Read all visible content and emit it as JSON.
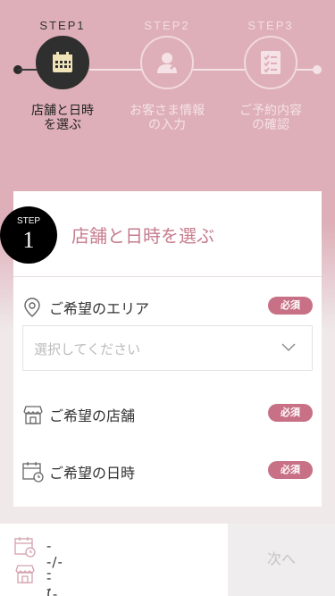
{
  "steps": [
    {
      "label": "STEP1",
      "text_line1": "店舗と日時",
      "text_line2": "を選ぶ",
      "icon": "calendar-icon",
      "active": true
    },
    {
      "label": "STEP2",
      "text_line1": "お客さま情報",
      "text_line2": "の入力",
      "icon": "person-icon",
      "active": false
    },
    {
      "label": "STEP3",
      "text_line1": "ご予約内容",
      "text_line2": "の確認",
      "icon": "checklist-icon",
      "active": false
    }
  ],
  "card": {
    "badge_word": "STEP",
    "badge_number": "1",
    "title": "店舗と日時を選ぶ"
  },
  "fields": {
    "area": {
      "label": "ご希望のエリア",
      "required": "必須",
      "placeholder": "選択してください",
      "icon": "location-pin-icon"
    },
    "store": {
      "label": "ご希望の店舗",
      "required": "必須",
      "icon": "store-icon"
    },
    "datetime": {
      "label": "ご希望の日時",
      "required": "必須",
      "icon": "calendar-clock-icon"
    }
  },
  "bottom": {
    "date_value": "--/--(--)",
    "store_value": "--",
    "next_label": "次へ"
  },
  "colors": {
    "brand_pink": "#deafb8",
    "accent": "#c87186",
    "title_pink": "#c77c8e"
  }
}
